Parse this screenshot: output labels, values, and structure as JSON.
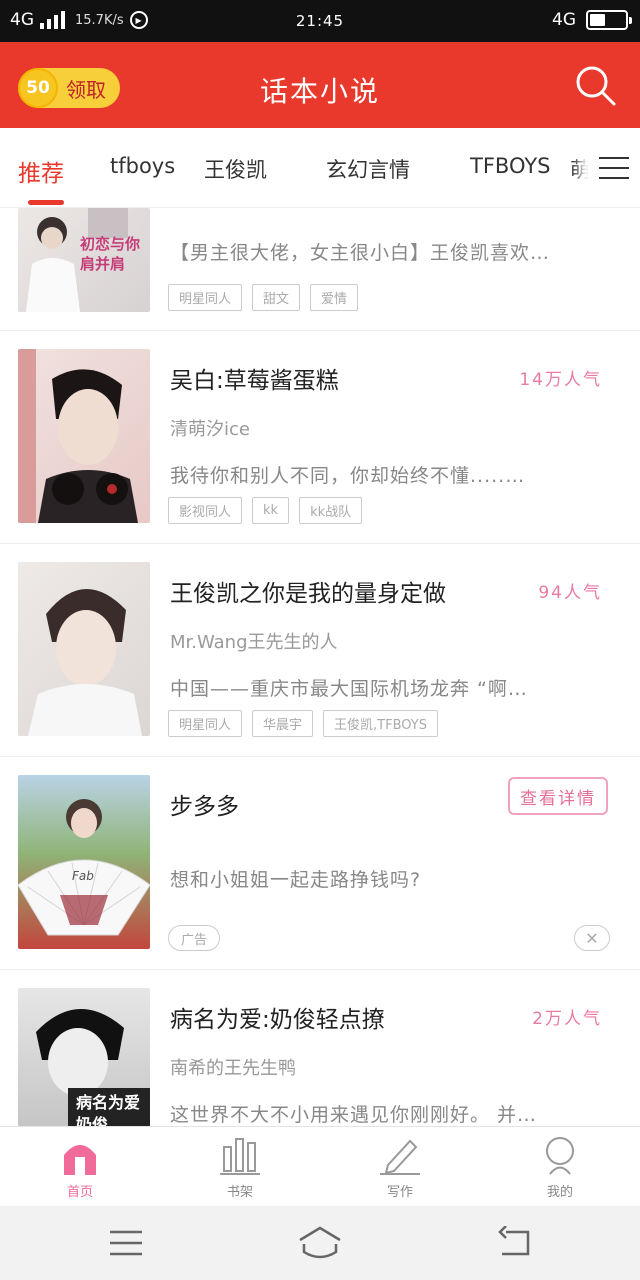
{
  "status_bar": {
    "network": "4G",
    "speed": "15.7K/s",
    "time": "21:45",
    "network_right": "4G",
    "battery_level": 0.45
  },
  "header": {
    "coins": "50",
    "coin_label": "领取",
    "title": "话本小说",
    "brand_color": "#e8392c"
  },
  "tabs": [
    {
      "label": "推荐",
      "active": true
    },
    {
      "label": "tfboys"
    },
    {
      "label": "王俊凯"
    },
    {
      "label": "玄幻言情"
    },
    {
      "label": "TFBOYS"
    },
    {
      "label": "萌"
    }
  ],
  "list": {
    "items": [
      {
        "title": "",
        "desc": "【男主很大佬，女主很小白】王俊凯喜欢…",
        "cover_text": "初恋与你肩并肩",
        "tags": [
          "明星同人",
          "甜文",
          "爱情"
        ]
      },
      {
        "title": "吴白:草莓酱蛋糕",
        "popularity": "14万人气",
        "author": "清萌汐ice",
        "desc": "我待你和别人不同，你却始终不懂.....…",
        "tags": [
          "影视同人",
          "kk",
          "kk战队"
        ]
      },
      {
        "title": "王俊凯之你是我的量身定做",
        "popularity": "94人气",
        "author": "Mr.Wang王先生的人",
        "desc": "中国——重庆市最大国际机场龙奔 “啊…",
        "tags": [
          "明星同人",
          "华晨宇",
          "王俊凯,TFBOYS"
        ]
      },
      {
        "title": "步多多",
        "desc": "想和小姐姐一起走路挣钱吗?",
        "detail_button": "查看详情",
        "ad_label": "广告",
        "fan_text": "Fab"
      },
      {
        "title": "病名为爱:奶俊轻点撩",
        "popularity": "2万人气",
        "author": "南希的王先生鸭",
        "desc": "这世界不大不小用来遇见你刚刚好。 并…",
        "cover_text": "病名为爱 奶俊"
      }
    ]
  },
  "bottom_nav": [
    {
      "label": "首页",
      "icon": "home-icon",
      "active": true
    },
    {
      "label": "书架",
      "icon": "bookshelf-icon"
    },
    {
      "label": "写作",
      "icon": "pencil-icon"
    },
    {
      "label": "我的",
      "icon": "profile-icon"
    }
  ],
  "colors": {
    "accent": "#e8392c",
    "popularity": "#e97aa3",
    "nav_active": "#f06b9a"
  }
}
